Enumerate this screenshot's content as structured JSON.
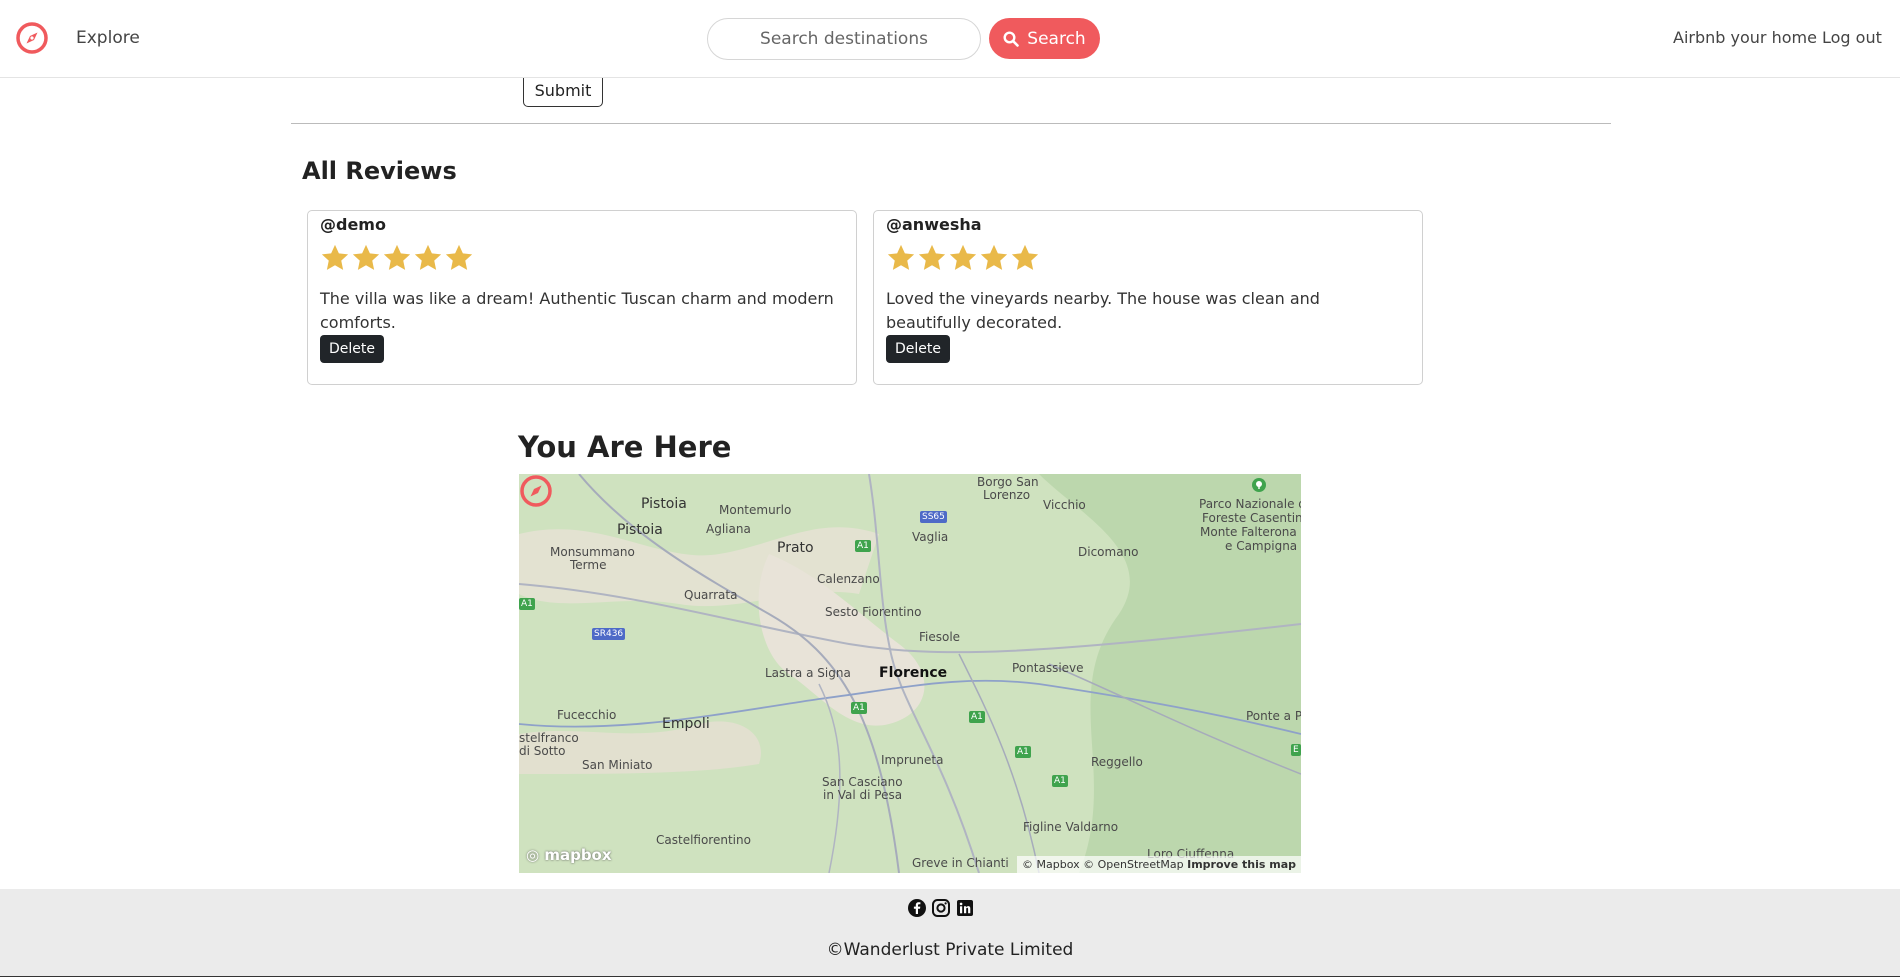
{
  "navbar": {
    "explore_label": "Explore",
    "search_placeholder": "Search destinations",
    "search_button_label": "Search",
    "host_label": "Airbnb your home",
    "logout_label": "Log out",
    "brand_color": "#f05a5d"
  },
  "review_form": {
    "submit_label": "Submit"
  },
  "reviews": {
    "heading": "All Reviews",
    "items": [
      {
        "author": "@demo",
        "rating": 5,
        "max_rating": 5,
        "comment": "The villa was like a dream! Authentic Tuscan charm and modern comforts.",
        "delete_label": "Delete"
      },
      {
        "author": "@anwesha",
        "rating": 5,
        "max_rating": 5,
        "comment": "Loved the vineyards nearby. The house was clean and beautifully decorated.",
        "delete_label": "Delete"
      }
    ],
    "star_color": "#e9b949"
  },
  "map": {
    "heading": "You Are Here",
    "labels": {
      "pistoia_1": "Pistoia",
      "pistoia_2": "Pistoia",
      "montemurlo": "Montemurlo",
      "agliana": "Agliana",
      "prato": "Prato",
      "monsummano": "Monsummano",
      "terme": "Terme",
      "quarrata": "Quarrata",
      "calenzano": "Calenzano",
      "sesto": "Sesto Fiorentino",
      "borgo_1": "Borgo San",
      "borgo_2": "Lorenzo",
      "vicchio": "Vicchio",
      "vaglia": "Vaglia",
      "dicomano": "Dicomano",
      "parco_1": "Parco Nazionale del",
      "parco_2": "Foreste Casentine",
      "parco_3": "Monte Falterona",
      "parco_4": "e Campigna",
      "fiesole": "Fiesole",
      "lastra": "Lastra a Signa",
      "florence": "Florence",
      "pontassieve": "Pontassieve",
      "fucecchio": "Fucecchio",
      "empoli": "Empoli",
      "castelfranco_1": "stelfranco",
      "castelfranco_2": "di Sotto",
      "san_miniato": "San Miniato",
      "impruneta": "Impruneta",
      "reggello": "Reggello",
      "ponte": "Ponte a Po",
      "san_casciano_1": "San Casciano",
      "san_casciano_2": "in Val di Pesa",
      "figline": "Figline Valdarno",
      "castelfiorentino": "Castelfiorentino",
      "greve": "Greve in Chianti",
      "loro": "Loro Ciuffenna",
      "badge_ss65": "SS65",
      "badge_sr436": "SR436",
      "badge_a1": "A1",
      "badge_e": "E"
    },
    "logo_text": "mapbox",
    "attribution_mapbox": "© Mapbox",
    "attribution_osm": "© OpenStreetMap",
    "attribution_improve": "Improve this map"
  },
  "footer": {
    "social_icons": [
      "facebook-icon",
      "instagram-icon",
      "linkedin-icon"
    ],
    "copyright": "©Wanderlust Private Limited"
  }
}
